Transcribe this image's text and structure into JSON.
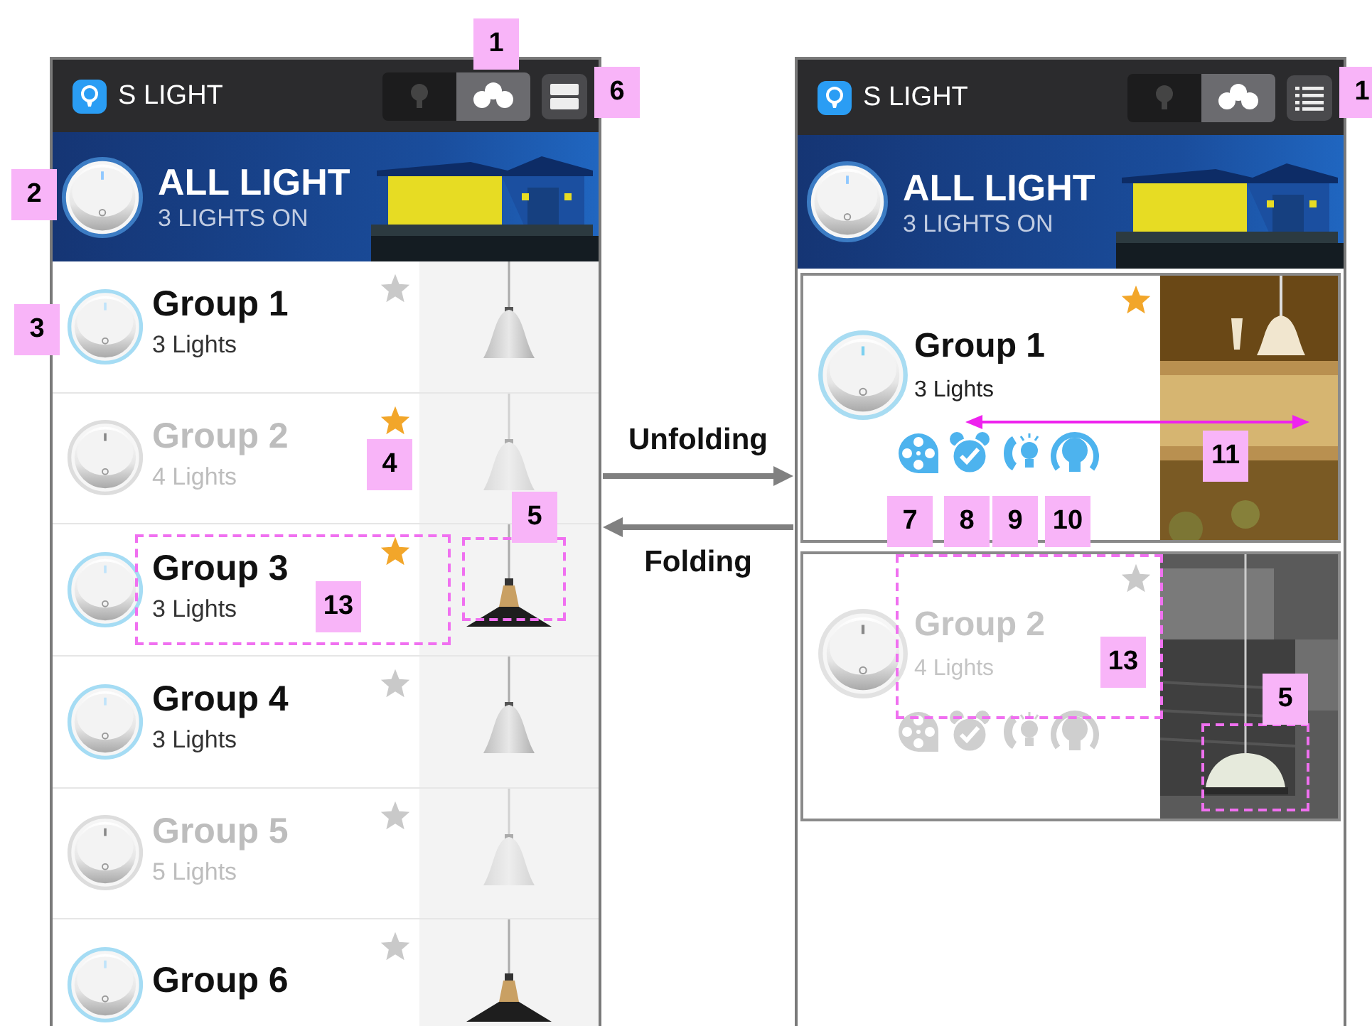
{
  "left_phone": {
    "header": {
      "title": "S LIGHT",
      "view_toggle": [
        {
          "kind": "single",
          "selected": false
        },
        {
          "kind": "group",
          "selected": true
        }
      ],
      "menu": {
        "kind": "rows"
      },
      "toggle_callout": "1",
      "menu_callout": "6"
    },
    "banner": {
      "title": "ALL LIGHT",
      "subtitle": "3 LIGHTS ON",
      "on": true,
      "callout": "2"
    },
    "groups": [
      {
        "name": "Group 1",
        "count": "3 Lights",
        "on": true,
        "starred": false,
        "lamp": {
          "kind": "white"
        },
        "callout": "3"
      },
      {
        "name": "Group 2",
        "count": "4 Lights",
        "on": false,
        "starred": true,
        "lamp": {
          "kind": "white"
        },
        "star_callout": "4"
      },
      {
        "name": "Group 3",
        "count": "3 Lights",
        "on": true,
        "starred": true,
        "lamp": {
          "kind": "black"
        },
        "text_callout": "13",
        "lamp_callout": "5"
      },
      {
        "name": "Group 4",
        "count": "3 Lights",
        "on": true,
        "starred": false,
        "lamp": {
          "kind": "white"
        }
      },
      {
        "name": "Group 5",
        "count": "5 Lights",
        "on": false,
        "starred": false,
        "lamp": {
          "kind": "white"
        }
      },
      {
        "name": "Group 6",
        "on": true,
        "starred": false,
        "lamp": {
          "kind": "black"
        }
      }
    ]
  },
  "transitions": [
    {
      "label": "Unfolding",
      "kind": "right"
    },
    {
      "label": "Folding",
      "kind": "left"
    }
  ],
  "right_phone": {
    "header": {
      "title": "S LIGHT",
      "view_toggle": [
        {
          "kind": "single",
          "selected": false
        },
        {
          "kind": "group",
          "selected": true
        }
      ],
      "menu": {
        "kind": "list"
      },
      "menu_callout": "1"
    },
    "banner": {
      "title": "ALL LIGHT",
      "subtitle": "3 LIGHTS ON",
      "on": true
    },
    "cards": [
      {
        "name": "Group 1",
        "count": "3 Lights",
        "on": true,
        "starred": true,
        "icon_callouts": [
          "7",
          "8",
          "9",
          "10"
        ],
        "photo_callout": "11"
      },
      {
        "name": "Group 2",
        "count": "4 Lights",
        "on": false,
        "starred": false,
        "text_callout": "13",
        "lamp_callout": "5"
      }
    ]
  }
}
